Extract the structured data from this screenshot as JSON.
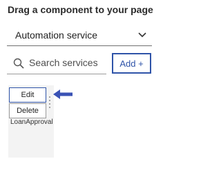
{
  "panel": {
    "heading": "Drag a component to your page"
  },
  "filter": {
    "selected": "Automation service",
    "icon": "chevron-down-icon"
  },
  "search": {
    "placeholder": "Search services",
    "value": "",
    "icon": "search-icon"
  },
  "add_button": {
    "label": "Add +",
    "color": "#2e53a8"
  },
  "component": {
    "name": "LoanApproval"
  },
  "context_menu": {
    "items": [
      {
        "label": "Edit"
      },
      {
        "label": "Delete"
      }
    ]
  },
  "annotation": {
    "arrow_color": "#3a52b5"
  }
}
